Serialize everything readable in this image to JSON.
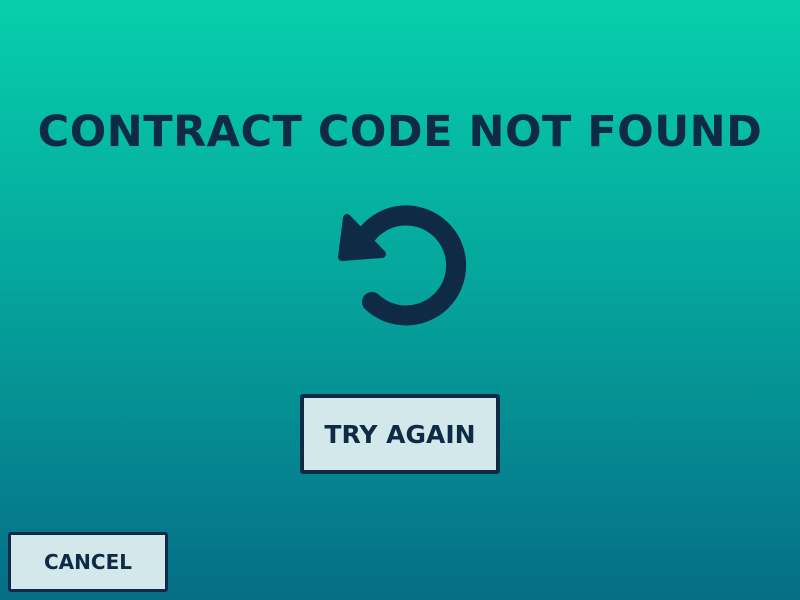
{
  "dialog": {
    "title": "CONTRACT CODE NOT FOUND",
    "icon": "retry-icon",
    "try_again_label": "TRY AGAIN",
    "cancel_label": "CANCEL"
  },
  "colors": {
    "background_top": "#07cfac",
    "background_bottom": "#056e86",
    "text": "#0f2a44",
    "button_fill": "#d3e8ea"
  }
}
